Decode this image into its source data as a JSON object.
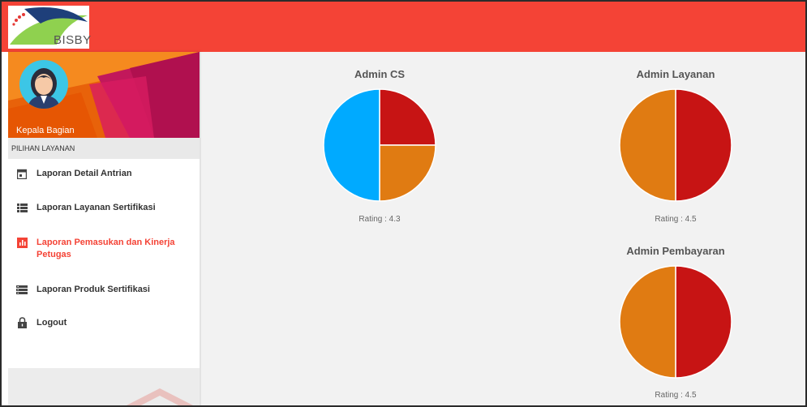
{
  "app": {
    "logo_text": "BISBY"
  },
  "user": {
    "role": "Kepala Bagian"
  },
  "sidebar": {
    "section_label": "PILIHAN LAYANAN",
    "items": [
      {
        "label": "Laporan Detail Antrian",
        "icon": "calendar-icon"
      },
      {
        "label": "Laporan Layanan Sertifikasi",
        "icon": "list-icon"
      },
      {
        "label_line1": "Laporan Pemasukan dan Kinerja",
        "label_line2": "Petugas",
        "icon": "bar-chart-icon",
        "active": true
      },
      {
        "label": "Laporan Produk Sertifikasi",
        "icon": "storage-icon"
      },
      {
        "label": "Logout",
        "icon": "lock-icon"
      }
    ]
  },
  "colors": {
    "accent": "#f44336",
    "red": "#c71414",
    "orange": "#e07b12",
    "blue": "#00aaff"
  },
  "chart_data": [
    {
      "type": "pie",
      "title": "Admin CS",
      "rating": "Rating : 4.3",
      "slices": [
        {
          "value": 25,
          "color": "#c71414"
        },
        {
          "value": 25,
          "color": "#e07b12"
        },
        {
          "value": 50,
          "color": "#00aaff"
        }
      ]
    },
    {
      "type": "pie",
      "title": "Admin Layanan",
      "rating": "Rating : 4.5",
      "slices": [
        {
          "value": 50,
          "color": "#c71414"
        },
        {
          "value": 50,
          "color": "#e07b12"
        }
      ]
    },
    {
      "type": "pie",
      "title": "Admin Pembayaran",
      "rating": "Rating : 4.5",
      "slices": [
        {
          "value": 50,
          "color": "#c71414"
        },
        {
          "value": 50,
          "color": "#e07b12"
        }
      ]
    }
  ]
}
